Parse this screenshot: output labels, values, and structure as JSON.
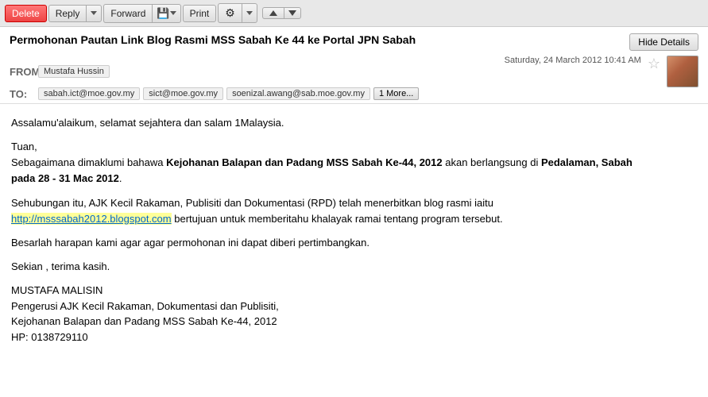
{
  "toolbar": {
    "delete_label": "Delete",
    "reply_label": "Reply",
    "forward_label": "Forward",
    "print_label": "Print"
  },
  "email": {
    "subject": "Permohonan Pautan Link Blog Rasmi MSS Sabah Ke 44 ke Portal JPN Sabah",
    "hide_details_label": "Hide Details",
    "from_label": "FROM:",
    "from_name": "Mustafa Hussin",
    "to_label": "TO:",
    "to_recipients": [
      "sabah.ict@moe.gov.my",
      "sict@moe.gov.my",
      "soenizal.awang@sab.moe.gov.my"
    ],
    "more_label": "1 More...",
    "date": "Saturday, 24 March 2012 10:41 AM",
    "star": "☆",
    "body": {
      "greeting": "Assalamu'alaikum, selamat sejahtera dan salam 1Malaysia.",
      "salutation": "Tuan,",
      "para1_before": "Sebagaimana dimaklumi bahawa ",
      "para1_bold": "Kejohanan Balapan dan Padang MSS Sabah Ke-44, 2012",
      "para1_middle": " akan berlangsung di ",
      "para1_bold2": "Pedalaman, Sabah",
      "para1_end_before": "",
      "para1_newline": "pada 28 - 31 Mac 2012",
      "para1_dot": ".",
      "para2": "Sehubungan itu, AJK Kecil Rakaman, Publisiti dan Dokumentasi (RPD) telah menerbitkan blog rasmi iaitu",
      "link": "http://msssabah2012.blogspot.com",
      "para2_end": " bertujuan untuk memberitahu khalayak ramai tentang program tersebut.",
      "para3": "Besarlah harapan kami agar agar permohonan ini dapat diberi pertimbangkan.",
      "para4": "Sekian , terima kasih.",
      "sig_name": "MUSTAFA MALISIN",
      "sig_line1": "Pengerusi AJK Kecil Rakaman, Dokumentasi dan Publisiti,",
      "sig_line2": "Kejohanan Balapan dan Padang MSS Sabah Ke-44, 2012",
      "sig_hp": "HP: 0138729110"
    }
  }
}
